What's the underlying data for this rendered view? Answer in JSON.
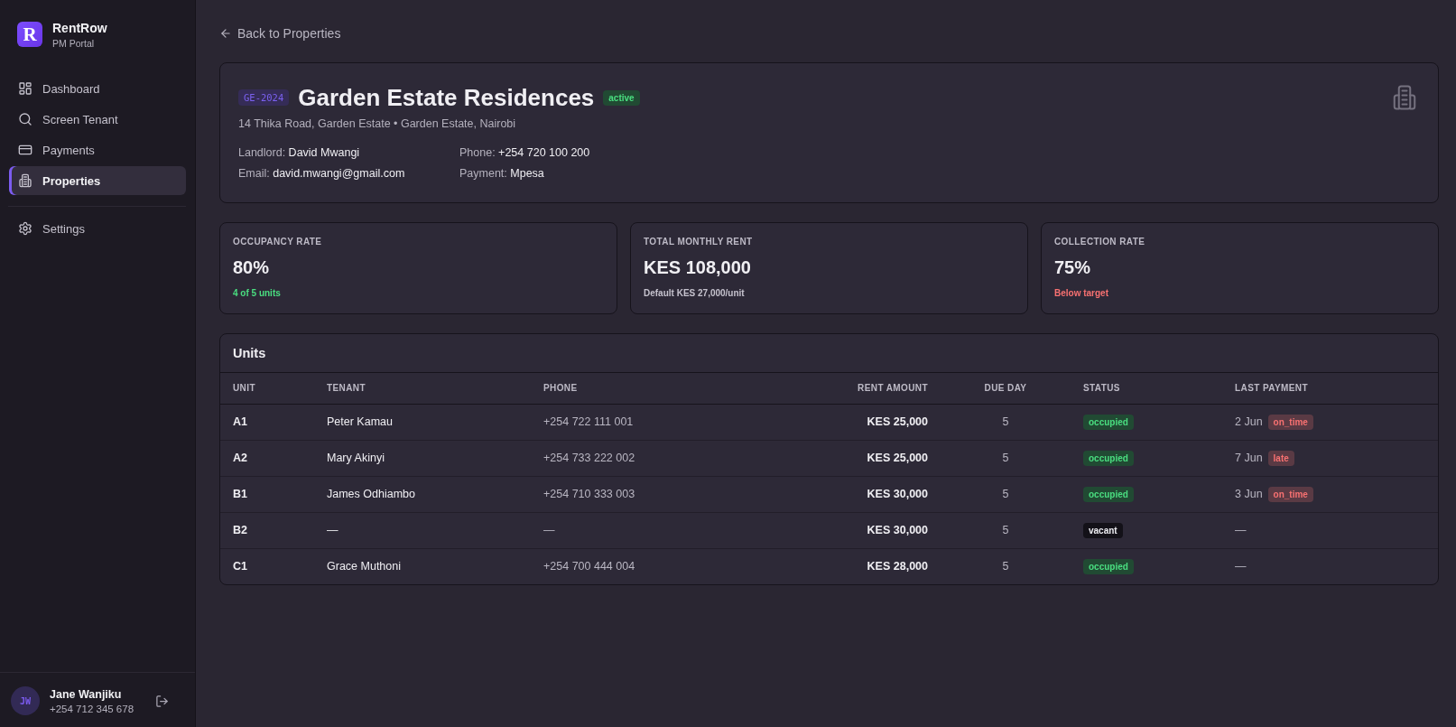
{
  "sidebar": {
    "brand": {
      "letter": "R",
      "name": "RentRow",
      "subtitle": "PM Portal"
    },
    "nav": [
      {
        "label": "Dashboard",
        "selected": false
      },
      {
        "label": "Screen Tenant",
        "selected": false
      },
      {
        "label": "Payments",
        "selected": false
      },
      {
        "label": "Properties",
        "selected": true
      }
    ],
    "secondary_nav": [
      {
        "label": "Settings",
        "selected": false
      }
    ],
    "user": {
      "initials": "JW",
      "name": "Jane Wanjiku",
      "phone": "+254 712 345 678"
    }
  },
  "back_link": "Back to Properties",
  "property": {
    "code": "GE-2024",
    "name": "Garden Estate Residences",
    "status": {
      "label": "active",
      "kind": "success"
    },
    "address": "14 Thika Road, Garden Estate • Garden Estate, Nairobi",
    "details": [
      {
        "label": "Landlord:",
        "value": "David Mwangi"
      },
      {
        "label": "Phone:",
        "value": "+254 720 100 200"
      },
      {
        "label": "Email:",
        "value": "david.mwangi@gmail.com"
      },
      {
        "label": "Payment:",
        "value": "Mpesa"
      }
    ]
  },
  "stats": [
    {
      "label": "OCCUPANCY RATE",
      "value": "80%",
      "note": "4 of 5 units",
      "kind": "positive"
    },
    {
      "label": "TOTAL MONTHLY RENT",
      "value": "KES 108,000",
      "note": "Default KES 27,000/unit",
      "kind": "neutral"
    },
    {
      "label": "COLLECTION RATE",
      "value": "75%",
      "note": "Below target",
      "kind": "negative"
    }
  ],
  "units": {
    "title": "Units",
    "columns": [
      "UNIT",
      "TENANT",
      "PHONE",
      "RENT AMOUNT",
      "DUE DAY",
      "STATUS",
      "LAST PAYMENT"
    ],
    "rows": [
      {
        "unit": "A1",
        "tenant": "Peter Kamau",
        "phone": "+254 722 111 001",
        "rent": "KES 25,000",
        "due_day": "5",
        "status": {
          "label": "occupied",
          "kind": "success"
        },
        "last_payment": {
          "date": "2 Jun",
          "status": {
            "label": "on_time",
            "kind": "danger"
          }
        }
      },
      {
        "unit": "A2",
        "tenant": "Mary Akinyi",
        "phone": "+254 733 222 002",
        "rent": "KES 25,000",
        "due_day": "5",
        "status": {
          "label": "occupied",
          "kind": "success"
        },
        "last_payment": {
          "date": "7 Jun",
          "status": {
            "label": "late",
            "kind": "danger"
          }
        }
      },
      {
        "unit": "B1",
        "tenant": "James Odhiambo",
        "phone": "+254 710 333 003",
        "rent": "KES 30,000",
        "due_day": "5",
        "status": {
          "label": "occupied",
          "kind": "success"
        },
        "last_payment": {
          "date": "3 Jun",
          "status": {
            "label": "on_time",
            "kind": "danger"
          }
        }
      },
      {
        "unit": "B2",
        "tenant": "—",
        "phone": "—",
        "rent": "KES 30,000",
        "due_day": "5",
        "status": {
          "label": "vacant",
          "kind": "neutral"
        },
        "last_payment": {
          "date": "—"
        }
      },
      {
        "unit": "C1",
        "tenant": "Grace Muthoni",
        "phone": "+254 700 444 004",
        "rent": "KES 28,000",
        "due_day": "5",
        "status": {
          "label": "occupied",
          "kind": "success"
        },
        "last_payment": {
          "date": "—"
        }
      }
    ]
  }
}
